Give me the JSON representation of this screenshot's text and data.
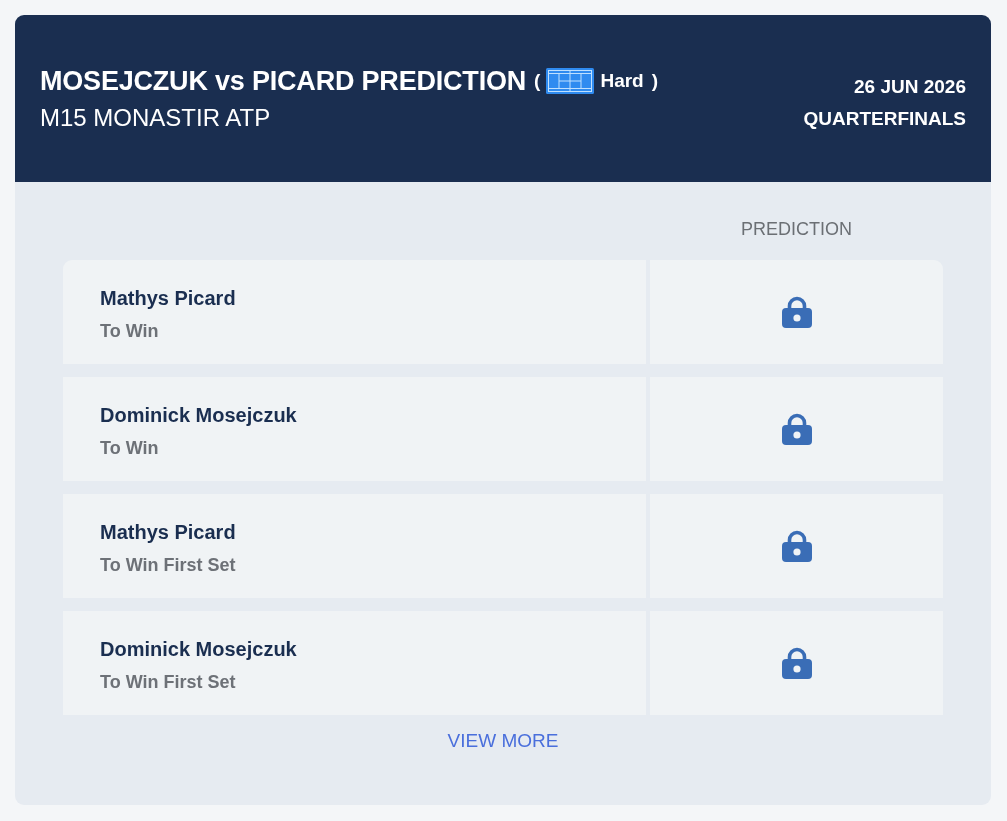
{
  "header": {
    "title": "MOSEJCZUK vs PICARD PREDICTION",
    "surface": {
      "kind": "hard",
      "open": "(",
      "label": "Hard",
      "close": ")"
    },
    "tournament": "M15 MONASTIR ATP",
    "date": "26 JUN 2026",
    "round": "QUARTERFINALS"
  },
  "table": {
    "column_header": "PREDICTION",
    "rows": [
      {
        "player": "Mathys Picard",
        "market": "To Win",
        "locked": true
      },
      {
        "player": "Dominick Mosejczuk",
        "market": "To Win",
        "locked": true
      },
      {
        "player": "Mathys Picard",
        "market": "To Win First Set",
        "locked": true
      },
      {
        "player": "Dominick Mosejczuk",
        "market": "To Win First Set",
        "locked": true
      }
    ]
  },
  "view_more": "VIEW MORE"
}
